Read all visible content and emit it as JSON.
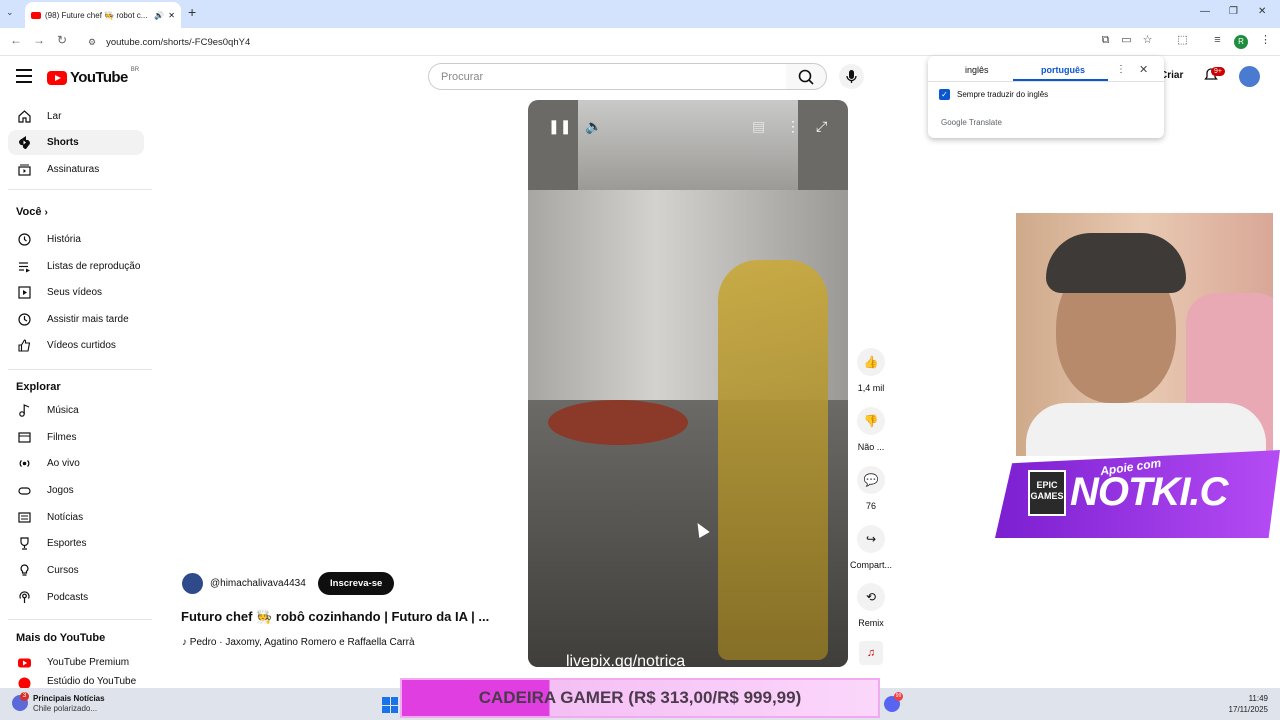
{
  "browser": {
    "tab_title": "(98) Future chef 🧑‍🍳 robot c...",
    "url": "youtube.com/shorts/-FC9es0qhY4"
  },
  "header": {
    "logo_text": "YouTube",
    "country_code": "BR",
    "search_placeholder": "Procurar",
    "create_label": "Criar",
    "notification_count": "9+",
    "avatar_letter": "R"
  },
  "sidebar": {
    "main": [
      {
        "label": "Lar",
        "icon": "home-icon"
      },
      {
        "label": "Shorts",
        "icon": "shorts-icon"
      },
      {
        "label": "Assinaturas",
        "icon": "subscriptions-icon"
      }
    ],
    "you_heading": "Você",
    "you": [
      {
        "label": "História",
        "icon": "history-icon"
      },
      {
        "label": "Listas de reprodução",
        "icon": "playlists-icon"
      },
      {
        "label": "Seus vídeos",
        "icon": "your-videos-icon"
      },
      {
        "label": "Assistir mais tarde",
        "icon": "watch-later-icon"
      },
      {
        "label": "Vídeos curtidos",
        "icon": "liked-videos-icon"
      }
    ],
    "explore_heading": "Explorar",
    "explore": [
      {
        "label": "Música",
        "icon": "music-icon"
      },
      {
        "label": "Filmes",
        "icon": "movies-icon"
      },
      {
        "label": "Ao vivo",
        "icon": "live-icon"
      },
      {
        "label": "Jogos",
        "icon": "gaming-icon"
      },
      {
        "label": "Notícias",
        "icon": "news-icon"
      },
      {
        "label": "Esportes",
        "icon": "sports-icon"
      },
      {
        "label": "Cursos",
        "icon": "courses-icon"
      },
      {
        "label": "Podcasts",
        "icon": "podcasts-icon"
      }
    ],
    "more_heading": "Mais do YouTube",
    "more": [
      {
        "label": "YouTube Premium",
        "icon": "youtube-premium-icon"
      },
      {
        "label": "Estúdio do YouTube",
        "icon": "youtube-studio-icon"
      }
    ]
  },
  "short": {
    "channel": "@himachalivava4434",
    "subscribe_label": "Inscreva-se",
    "title": "Futuro chef 🧑‍🍳 robô cozinhando | Futuro da IA | ...",
    "music": "Pedro · Jaxomy, Agatino Romero e Raffaella Carrà",
    "watermark": "livepix.gg/notrica"
  },
  "actions": {
    "likes": "1,4 mil",
    "dislike": "Não ...",
    "comments": "76",
    "share": "Compart...",
    "remix": "Remix"
  },
  "translate": {
    "source_lang": "inglês",
    "target_lang": "português",
    "always_translate": "Sempre traduzir do inglês",
    "google": "Google",
    "translate_word": "Translate"
  },
  "overlay": {
    "epic_text": "EPIC GAMES",
    "banner_text": "NOTKI.C",
    "apoie_text": "Apoie com"
  },
  "taskbar": {
    "news_badge": "3",
    "news_title": "Principais Notícias",
    "news_subtitle": "Chile polarizado...",
    "ticker": "CADEIRA GAMER (R$ 313,00/R$ 999,99)",
    "discord_badge": "99",
    "time": "11:49",
    "date": "17/11/2025"
  },
  "colors": {
    "youtube_red": "#ff0000",
    "accent_blue": "#0b57d0",
    "ticker_pink": "#e03ee0",
    "banner_purple": "#7b1fd0"
  }
}
